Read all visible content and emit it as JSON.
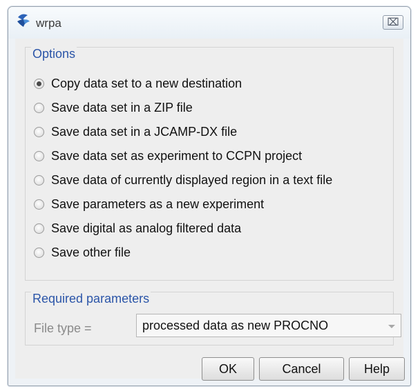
{
  "window": {
    "title": "wrpa",
    "close_glyph": "⌧",
    "icon": "bruker-app-icon"
  },
  "options": {
    "legend": "Options",
    "items": [
      {
        "label": "Copy data set to a new destination",
        "checked": true
      },
      {
        "label": "Save data set in a ZIP file",
        "checked": false
      },
      {
        "label": "Save data set in a JCAMP-DX file",
        "checked": false
      },
      {
        "label": "Save data set as experiment to CCPN project",
        "checked": false
      },
      {
        "label": "Save data of currently displayed region in a text file",
        "checked": false
      },
      {
        "label": "Save parameters as a new experiment",
        "checked": false
      },
      {
        "label": "Save digital as analog filtered data",
        "checked": false
      },
      {
        "label": "Save other file",
        "checked": false
      }
    ]
  },
  "params": {
    "legend": "Required parameters",
    "file_type_label": "File type =",
    "file_type_value": "processed data as new PROCNO"
  },
  "buttons": {
    "ok": "OK",
    "cancel": "Cancel",
    "help": "Help"
  },
  "colors": {
    "group_title": "#2b55a8",
    "dialog_bg": "#eeeeee"
  }
}
